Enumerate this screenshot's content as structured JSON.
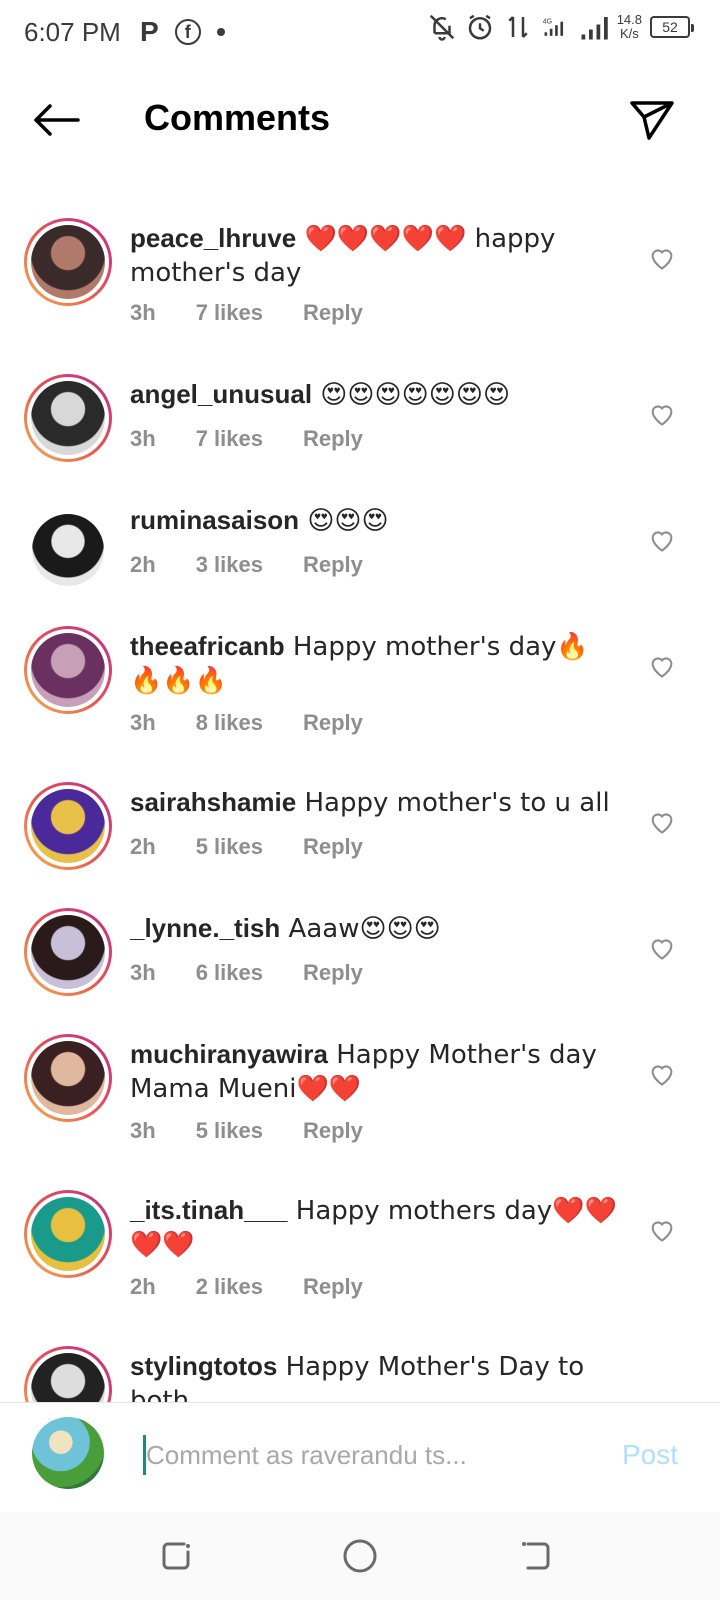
{
  "status_bar": {
    "time": "6:07 PM",
    "left_icons": [
      "p-icon",
      "facebook-icon",
      "dot-icon"
    ],
    "speed_value": "14.8",
    "speed_unit": "K/s",
    "battery": "52",
    "network": "4G"
  },
  "header": {
    "title": "Comments"
  },
  "comments": [
    {
      "username": "peace_lhruve",
      "text": " ❤️❤️❤️❤️❤️ happy mother's day",
      "time": "3h",
      "likes": "7 likes",
      "reply": "Reply",
      "ring": true,
      "avatar_colors": [
        "#3b2a2a",
        "#b07a6a"
      ]
    },
    {
      "username": "angel_unusual",
      "text": " 😍😍😍😍😍😍😍",
      "time": "3h",
      "likes": "7 likes",
      "reply": "Reply",
      "ring": true,
      "avatar_colors": [
        "#2a2a2a",
        "#d8d8d8"
      ]
    },
    {
      "username": "ruminasaison",
      "text": " 😍😍😍",
      "time": "2h",
      "likes": "3 likes",
      "reply": "Reply",
      "ring": false,
      "avatar_colors": [
        "#1a1a1a",
        "#e8e8e8"
      ]
    },
    {
      "username": "theeafricanb",
      "text": " Happy mother's day🔥🔥🔥🔥",
      "time": "3h",
      "likes": "8 likes",
      "reply": "Reply",
      "ring": true,
      "avatar_colors": [
        "#6a3060",
        "#c7a0b8"
      ]
    },
    {
      "username": "sairahshamie",
      "text": " Happy mother's to u all",
      "time": "2h",
      "likes": "5 likes",
      "reply": "Reply",
      "ring": true,
      "avatar_colors": [
        "#4a2a9a",
        "#e8c04a"
      ]
    },
    {
      "username": "_lynne._tish",
      "text": " Aaaw😍😍😍",
      "time": "3h",
      "likes": "6 likes",
      "reply": "Reply",
      "ring": true,
      "avatar_colors": [
        "#2a1a1a",
        "#c8c0d8"
      ]
    },
    {
      "username": "muchiranyawira",
      "text": " Happy Mother's day Mama Mueni❤️❤️",
      "time": "3h",
      "likes": "5 likes",
      "reply": "Reply",
      "ring": true,
      "avatar_colors": [
        "#3a2020",
        "#e0b8a0"
      ]
    },
    {
      "username": "_its.tinah___",
      "text": " Happy mothers day❤️❤️❤️❤️",
      "time": "2h",
      "likes": "2 likes",
      "reply": "Reply",
      "ring": true,
      "avatar_colors": [
        "#1a9a8a",
        "#e8c040"
      ]
    },
    {
      "username": "stylingtotos",
      "text": " Happy Mother's Day to both",
      "time": "",
      "likes": "",
      "reply": "",
      "ring": true,
      "avatar_colors": [
        "#222222",
        "#dddddd"
      ]
    }
  ],
  "input": {
    "placeholder": "Comment as raverandu ts...",
    "post_label": "Post"
  },
  "nav": [
    "recents-button",
    "home-button",
    "back-nav-button"
  ]
}
